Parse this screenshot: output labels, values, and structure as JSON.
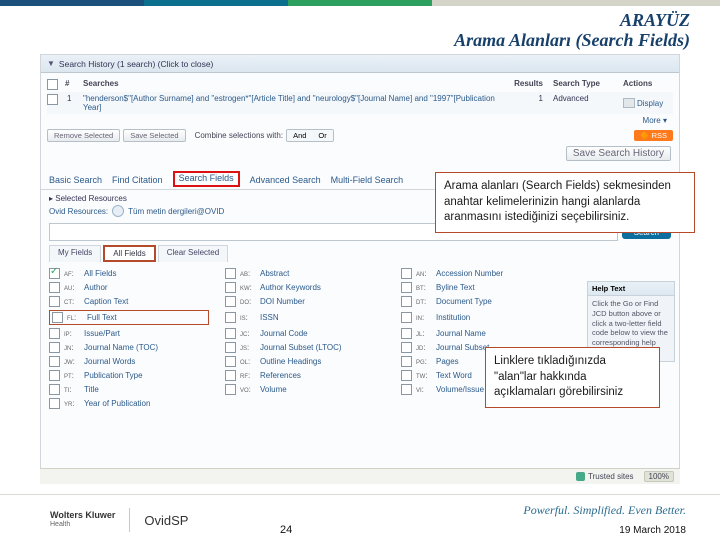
{
  "slide": {
    "title_line1": "ARAYÜZ",
    "title_line2": "Arama Alanları (Search Fields)",
    "page_number": "24",
    "date": "19 March 2018",
    "tagline": "Powerful. Simplified. Even Better."
  },
  "branding": {
    "wk_line1": "Wolters Kluwer",
    "wk_line2": "Health",
    "ovid": "OvidSP"
  },
  "search_history": {
    "header": "Search History  (1 search)  (Click to close)",
    "cols": {
      "num": "#",
      "searches": "Searches",
      "results": "Results",
      "type": "Search Type",
      "actions": "Actions"
    },
    "row": {
      "num": "1",
      "query": "\"henderson$\"[Author Surname] and \"estrogen*\"[Article Title] and \"neurology$\"[Journal Name] and \"1997\"[Publication Year]",
      "results": "1",
      "type": "Advanced"
    },
    "more": "More ▾",
    "buttons": {
      "remove": "Remove Selected",
      "save": "Save Selected"
    },
    "combine_label": "Combine selections with:",
    "seg_and": "And",
    "seg_or": "Or",
    "rss": "RSS",
    "save_history": "Save Search History"
  },
  "tabs": {
    "basic": "Basic Search",
    "find": "Find Citation",
    "fields": "Search Fields",
    "advanced": "Advanced Search",
    "multi": "Multi-Field Search"
  },
  "selected_resources": {
    "toggle": "▸ Selected Resources",
    "link": "Ovid Resources:",
    "db": "Tüm metin dergileri@OVID"
  },
  "search_btn": "Search",
  "field_tabs": {
    "my": "My Fields",
    "all": "All Fields",
    "clear": "Clear Selected"
  },
  "fields": [
    {
      "code": "af:",
      "label": "All Fields",
      "checked": true
    },
    {
      "code": "ab:",
      "label": "Abstract"
    },
    {
      "code": "an:",
      "label": "Accession Number"
    },
    {
      "code": "au:",
      "label": "Author"
    },
    {
      "code": "kw:",
      "label": "Author Keywords"
    },
    {
      "code": "bt:",
      "label": "Byline Text"
    },
    {
      "code": "ct:",
      "label": "Caption Text"
    },
    {
      "code": "do:",
      "label": "DOI Number"
    },
    {
      "code": "dt:",
      "label": "Document Type"
    },
    {
      "code": "fl:",
      "label": "Full Text"
    },
    {
      "code": "is:",
      "label": "ISSN"
    },
    {
      "code": "in:",
      "label": "Institution"
    },
    {
      "code": "ip:",
      "label": "Issue/Part"
    },
    {
      "code": "jc:",
      "label": "Journal Code"
    },
    {
      "code": "jl:",
      "label": "Journal Name"
    },
    {
      "code": "jn:",
      "label": "Journal Name (TOC)"
    },
    {
      "code": "js:",
      "label": "Journal Subset (LTOC)"
    },
    {
      "code": "jd:",
      "label": "Journal Subset"
    },
    {
      "code": "jw:",
      "label": "Journal Words"
    },
    {
      "code": "ol:",
      "label": "Outline Headings"
    },
    {
      "code": "pg:",
      "label": "Pages"
    },
    {
      "code": "pt:",
      "label": "Publication Type"
    },
    {
      "code": "rf:",
      "label": "References"
    },
    {
      "code": "tw:",
      "label": "Text Word"
    },
    {
      "code": "ti:",
      "label": "Title"
    },
    {
      "code": "vo:",
      "label": "Volume"
    },
    {
      "code": "vi:",
      "label": "Volume/Issue (LOI)"
    },
    {
      "code": "yr:",
      "label": "Year of Publication"
    }
  ],
  "help_text": {
    "title": "Help Text",
    "body": "Click the Go or Find JCD button above or click a two-letter field code below to view the corresponding help text."
  },
  "callouts": {
    "c1": "Arama alanları (Search Fields) sekmesinden\nanahtar kelimelerinizin hangi alanlarda aranmasını istediğinizi seçebilirsiniz.",
    "c2": "Linklere tıkladığınızda \"alan\"lar hakkında açıklamaları görebilirsiniz"
  },
  "trust": {
    "trusted": "Trusted sites",
    "zoom": "100%"
  }
}
